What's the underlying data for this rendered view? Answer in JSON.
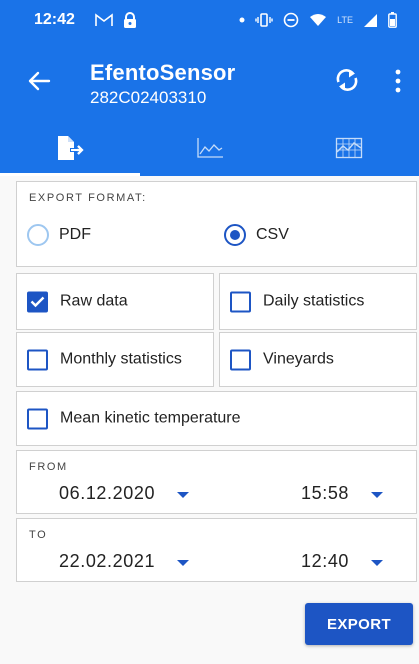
{
  "status_bar": {
    "time": "12:42",
    "network_label": "LTE",
    "icons": [
      "gmail-icon",
      "lock-icon",
      "dot-icon",
      "vibrate-icon",
      "dnd-icon",
      "wifi-icon",
      "signal-icon",
      "battery-icon"
    ]
  },
  "app_bar": {
    "title": "EfentoSensor",
    "subtitle": "282C02403310",
    "icons": [
      "back-arrow-icon",
      "sync-icon",
      "more-vert-icon"
    ]
  },
  "tabs": [
    {
      "name": "export",
      "icon": "export-file-icon",
      "active": true
    },
    {
      "name": "chart",
      "icon": "line-chart-icon",
      "active": false
    },
    {
      "name": "grid-chart",
      "icon": "grid-chart-icon",
      "active": false
    }
  ],
  "export_format": {
    "label": "EXPORT FORMAT:",
    "options": [
      {
        "label": "PDF",
        "selected": false
      },
      {
        "label": "CSV",
        "selected": true
      }
    ]
  },
  "options": [
    {
      "label": "Raw data",
      "checked": true
    },
    {
      "label": "Daily statistics",
      "checked": false
    },
    {
      "label": "Monthly statistics",
      "checked": false
    },
    {
      "label": "Vineyards",
      "checked": false
    },
    {
      "label": "Mean kinetic temperature",
      "checked": false
    }
  ],
  "from": {
    "label": "FROM",
    "date": "06.12.2020",
    "time": "15:58"
  },
  "to": {
    "label": "TO",
    "date": "22.02.2021",
    "time": "12:40"
  },
  "export_button": {
    "label": "EXPORT"
  },
  "colors": {
    "primary": "#1a73e8",
    "accent": "#1d55c4",
    "radio_inactive": "#9ec7f0",
    "background": "#f9f9f9"
  }
}
